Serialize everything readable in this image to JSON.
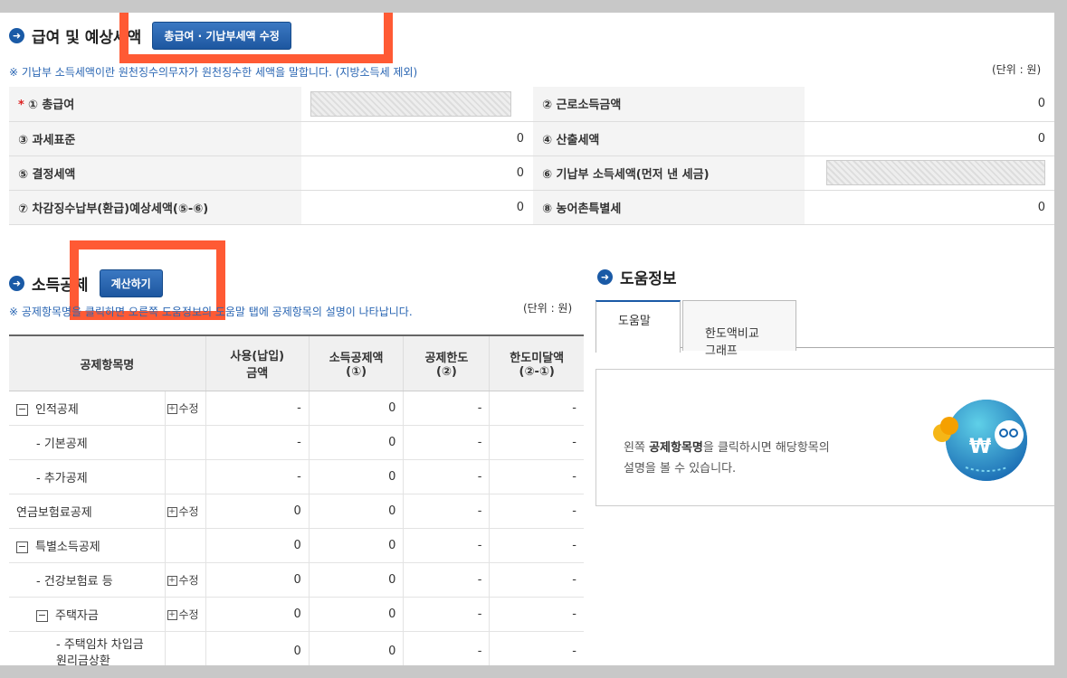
{
  "salary_section": {
    "title": "급여 및 예상세액",
    "edit_button": "총급여 · 기납부세액 수정",
    "note": "※ 기납부 소득세액이란 원천징수의무자가 원천징수한 세액을 말합니다. (지방소득세 제외)",
    "unit": "(단위 : 원)",
    "rows": [
      {
        "left_label": "① 총급여",
        "left_value": "",
        "right_label": "② 근로소득금액",
        "right_value": "0"
      },
      {
        "left_label": "③ 과세표준",
        "left_value": "0",
        "right_label": "④ 산출세액",
        "right_value": "0"
      },
      {
        "left_label": "⑤ 결정세액",
        "left_value": "0",
        "right_label": "⑥ 기납부 소득세액(먼저 낸 세금)",
        "right_value": ""
      },
      {
        "left_label": "⑦ 차감징수납부(환급)예상세액(⑤-⑥)",
        "left_value": "0",
        "right_label": "⑧ 농어촌특별세",
        "right_value": "0"
      }
    ]
  },
  "deduction_section": {
    "title": "소득공제",
    "calc_button": "계산하기",
    "note": "※ 공제항목명을 클릭하면 오른쪽 도움정보의 도움말 탭에 공제항목의 설명이 나타납니다.",
    "unit": "(단위 : 원)",
    "headers": [
      "공제항목명",
      "사용(납입)\n금액",
      "소득공제액\n(①)",
      "공제한도\n(②)",
      "한도미달액\n(②-①)"
    ],
    "rows": [
      {
        "name": "인적공제",
        "toggle": true,
        "indent": 0,
        "edit": "수정",
        "used": "-",
        "ded": "0",
        "limit": "-",
        "short": "-"
      },
      {
        "name": "- 기본공제",
        "toggle": false,
        "indent": 1,
        "edit": "",
        "used": "-",
        "ded": "0",
        "limit": "-",
        "short": "-"
      },
      {
        "name": "- 추가공제",
        "toggle": false,
        "indent": 1,
        "edit": "",
        "used": "-",
        "ded": "0",
        "limit": "-",
        "short": "-"
      },
      {
        "name": "연금보험료공제",
        "toggle": false,
        "indent": 0,
        "edit": "수정",
        "used": "0",
        "ded": "0",
        "limit": "-",
        "short": "-"
      },
      {
        "name": "특별소득공제",
        "toggle": true,
        "indent": 0,
        "edit": "",
        "used": "0",
        "ded": "0",
        "limit": "-",
        "short": "-"
      },
      {
        "name": "- 건강보험료 등",
        "toggle": false,
        "indent": 1,
        "edit": "수정",
        "used": "0",
        "ded": "0",
        "limit": "-",
        "short": "-"
      },
      {
        "name": "주택자금",
        "toggle": true,
        "indent": 1,
        "edit": "수정",
        "used": "0",
        "ded": "0",
        "limit": "-",
        "short": "-"
      },
      {
        "name": "- 주택임차 차입금 원리금상환",
        "toggle": false,
        "indent": 2,
        "edit": "",
        "used": "0",
        "ded": "0",
        "limit": "-",
        "short": "-"
      }
    ]
  },
  "help_section": {
    "title": "도움정보",
    "tabs": [
      "도움말",
      "한도액비교\n그래프"
    ],
    "text_prefix": "왼쪽 ",
    "text_bold": "공제항목명",
    "text_suffix": "을 클릭하시면 해당항목의",
    "text_line2": "설명을 볼 수 있습니다."
  },
  "colors": {
    "accent": "#1a5aa6",
    "highlight": "#ff5a34"
  }
}
